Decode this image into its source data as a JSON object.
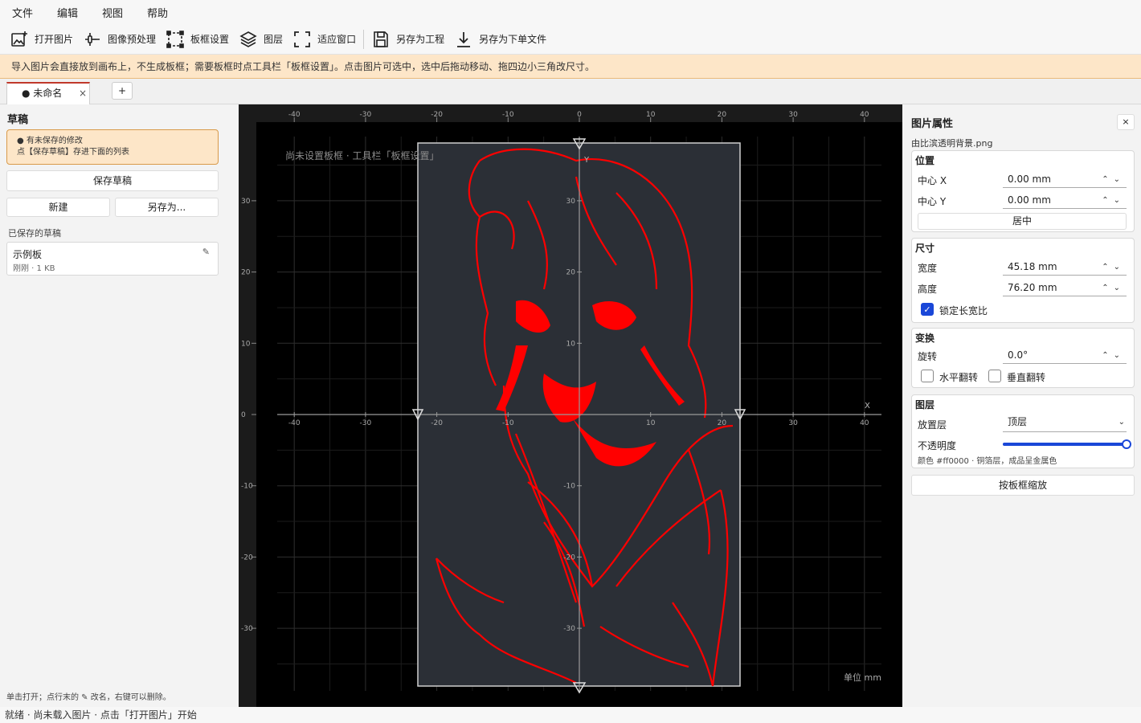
{
  "menu": [
    "文件",
    "编辑",
    "视图",
    "帮助"
  ],
  "toolbar": {
    "open_image": "打开图片",
    "preprocess": "图像预处理",
    "board_settings": "板框设置",
    "layers": "图层",
    "fit_window": "适应窗口",
    "save_project": "另存为工程",
    "save_order": "另存为下单文件"
  },
  "notice": "导入图片会直接放到画布上，不生成板框；需要板框时点工具栏「板框设置」。点击图片可选中，选中后拖动移动、拖四边小三角改尺寸。",
  "tabs": {
    "active": "● 未命名",
    "close": "×",
    "add": "+"
  },
  "drafts": {
    "title": "草稿",
    "warn_line1": "● 有未保存的修改",
    "warn_line2": "点【保存草稿】存进下面的列表",
    "save_btn": "保存草稿",
    "new_btn": "新建",
    "saveas_btn": "另存为...",
    "saved_label": "已保存的草稿",
    "items": [
      {
        "name": "示例板",
        "meta": "刚刚 · 1 KB",
        "edit_icon": "✎"
      }
    ],
    "hint": "单击打开；点行末的 ✎ 改名，右键可以删除。"
  },
  "canvas": {
    "overlay_note": "尚未设置板框  ·  工具栏「板框设置」",
    "unit": "单位 mm",
    "x_axis_label": "X",
    "y_axis_label": "Y",
    "ruler_ticks": [
      "-40",
      "-30",
      "-20",
      "-10",
      "0",
      "10",
      "20",
      "30",
      "40"
    ],
    "v_ruler_ticks": [
      "30",
      "20",
      "10",
      "0",
      "-10",
      "-20",
      "-30"
    ],
    "inner_x_ticks": [
      "-40",
      "-30",
      "-20",
      "-10",
      "10",
      "20",
      "30",
      "40"
    ],
    "inner_y_ticks": [
      "30",
      "20",
      "10",
      "-10",
      "-20",
      "-30"
    ],
    "image_color": "#ff0000",
    "board_color": "#2b2f36"
  },
  "props": {
    "title": "图片属性",
    "close": "×",
    "filename": "由比滨透明背景.png",
    "position": {
      "title": "位置",
      "cx_label": "中心 X",
      "cx": "0.00 mm",
      "cy_label": "中心 Y",
      "cy": "0.00 mm",
      "center_btn": "居中"
    },
    "size": {
      "title": "尺寸",
      "w_label": "宽度",
      "w": "45.18 mm",
      "h_label": "高度",
      "h": "76.20 mm",
      "lock": "锁定长宽比"
    },
    "transform": {
      "title": "变换",
      "rot_label": "旋转",
      "rot": "0.0°",
      "hflip": "水平翻转",
      "vflip": "垂直翻转"
    },
    "layer": {
      "title": "图层",
      "place_label": "放置层",
      "place": "顶层",
      "opacity_label": "不透明度",
      "opacity": 1.0,
      "note": "颜色 #ff0000  ·  铜箔层，成品呈金属色"
    },
    "fit_btn": "按板框缩放"
  },
  "status": "就绪  ·  尚未载入图片  ·  点击「打开图片」开始"
}
